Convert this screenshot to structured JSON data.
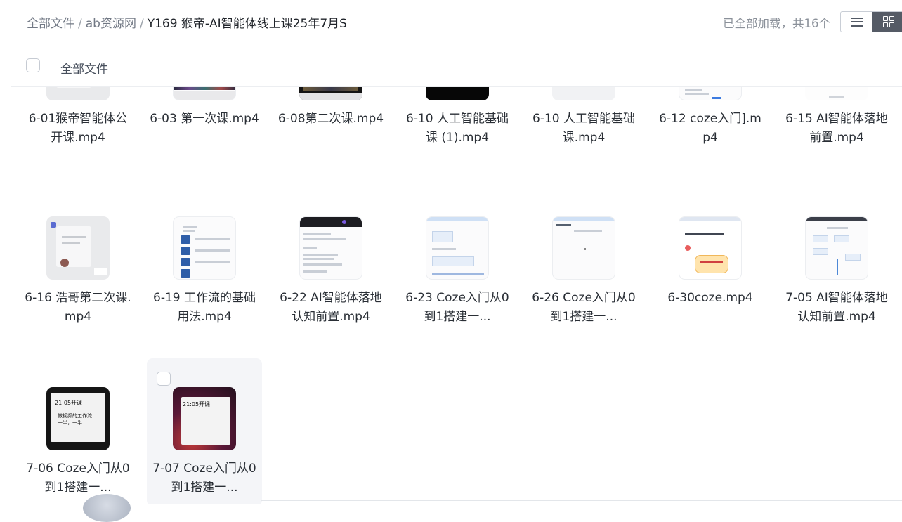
{
  "breadcrumb": {
    "root": "全部文件",
    "parent": "ab资源网",
    "separator": "/",
    "current": "Y169 猴帝-AI智能体线上课25年7月S"
  },
  "status": "已全部加载，共16个",
  "view_toggle": {
    "list_icon": "list-view-icon",
    "grid_icon": "grid-view-icon",
    "active": "grid"
  },
  "header": {
    "select_all_label": "全部文件"
  },
  "files": [
    {
      "name": "6-01猴帝智能体公开课.mp4",
      "thumb": "gray"
    },
    {
      "name": "6-03 第一次课.mp4",
      "thumb": "strip"
    },
    {
      "name": "6-08第二次课.mp4",
      "thumb": "strip-dark"
    },
    {
      "name": "6-10 人工智能基础课 (1).mp4",
      "thumb": "black"
    },
    {
      "name": "6-10 人工智能基础课.mp4",
      "thumb": "light"
    },
    {
      "name": "6-12 coze入门].mp4",
      "thumb": "doc"
    },
    {
      "name": "6-15 AI智能体落地前置.mp4",
      "thumb": "blank"
    },
    {
      "name": "6-16 浩哥第二次课.mp4",
      "thumb": "gray"
    },
    {
      "name": "6-19 工作流的基础用法.mp4",
      "thumb": "doc-blue"
    },
    {
      "name": "6-22 AI智能体落地认知前置.mp4",
      "thumb": "doc-dark"
    },
    {
      "name": "6-23 Coze入门从0到1搭建一...",
      "thumb": "doc-flow"
    },
    {
      "name": "6-26 Coze入门从0到1搭建一...",
      "thumb": "doc-plain"
    },
    {
      "name": "6-30coze.mp4",
      "thumb": "poster"
    },
    {
      "name": "7-05 AI智能体落地认知前置.mp4",
      "thumb": "doc-flow2"
    },
    {
      "name": "7-06 Coze入门从0到1搭建一...",
      "thumb": "dark-text",
      "thumb_text": [
        "21:05开课",
        "做视频的工作流",
        "一半，一半"
      ]
    },
    {
      "name": "7-07 Coze入门从0到1搭建一...",
      "thumb": "purple",
      "thumb_text": [
        "21:05开课"
      ]
    }
  ]
}
